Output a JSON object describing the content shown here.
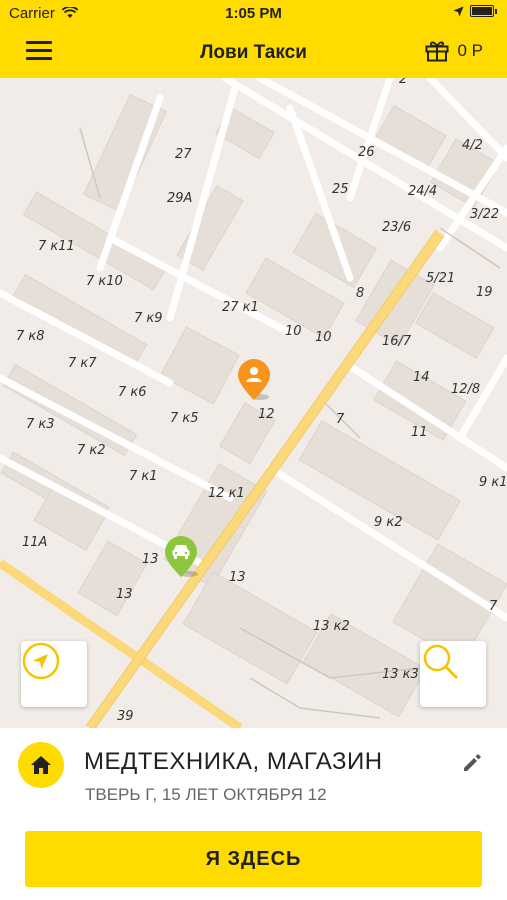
{
  "status_bar": {
    "carrier": "Carrier",
    "time": "1:05 PM"
  },
  "navbar": {
    "title": "Лови Такси",
    "bonus_value": "0 Р"
  },
  "map": {
    "labels": [
      "2",
      "27",
      "26",
      "4/2",
      "25",
      "24/4",
      "29A",
      "3/22",
      "23/6",
      "7 к11",
      "5/21",
      "7 к10",
      "19",
      "8",
      "27 к1",
      "7 к9",
      "10",
      "10",
      "16/7",
      "7 к8",
      "7 к7",
      "14",
      "12/8",
      "7 к6",
      "12",
      "7",
      "7 к5",
      "7 к3",
      "11",
      "7 к2",
      "7 к1",
      "9 к1",
      "12 к1",
      "9 к2",
      "11A",
      "13",
      "13",
      "13",
      "7",
      "13 к2",
      "13 к3",
      "39"
    ]
  },
  "location": {
    "name": "МЕДТЕХНИКА, МАГАЗИН",
    "address": "ТВЕРЬ Г, 15 ЛЕТ ОКТЯБРЯ 12"
  },
  "actions": {
    "confirm_label": "Я ЗДЕСЬ"
  },
  "colors": {
    "accent": "#ffdb00",
    "user_pin": "#f7941d",
    "taxi_pin": "#8cc63f",
    "map_bg": "#f1ece7",
    "road": "#fbd97a"
  }
}
